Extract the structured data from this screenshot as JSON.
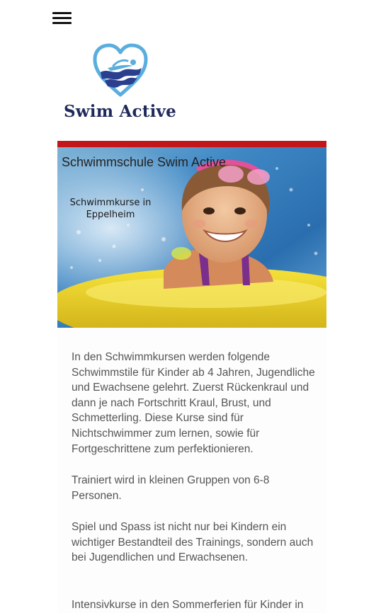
{
  "header": {
    "menu_icon": "hamburger-menu-icon"
  },
  "logo": {
    "icon": "swimmer-heart-icon",
    "text": "Swim Active",
    "colors": {
      "heart_outline": "#5aaede",
      "waves": "#2b3f8f",
      "text": "#1f2a5c"
    }
  },
  "hero": {
    "title": "Schwimmschule Swim Active",
    "subtitle": "Schwimmkurse in Eppelheim",
    "accent_bar_color": "#c2161b"
  },
  "body": {
    "paragraph_1": "In den Schwimmkursen werden folgende Schwimmstile für Kinder ab 4 Jahren, Jugendliche und Ewachsene gelehrt. Zuerst Rückenkraul und dann je nach Fortschritt Kraul, Brust, und Schmetterling. Diese Kurse sind für Nichtschwimmer zum lernen, sowie für Fortgeschrittene zum perfektionieren.",
    "paragraph_2": "Trainiert wird in kleinen Gruppen von 6-8 Personen.",
    "paragraph_3": "Spiel und Spass ist nicht nur bei Kindern ein wichtiger Bestandteil des Trainings, sondern auch bei Jugendlichen und Erwachsenen.",
    "paragraph_4": "Intensivkurse in den Sommerferien für Kinder in"
  }
}
